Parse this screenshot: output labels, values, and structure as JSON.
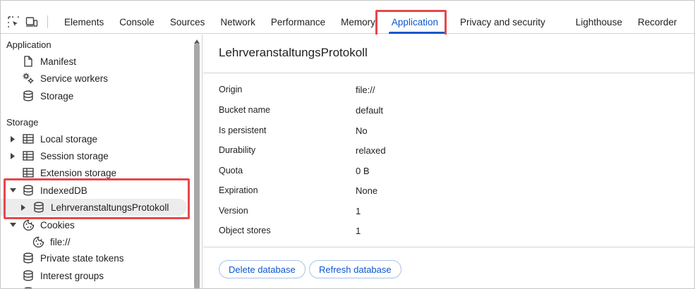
{
  "tabs": [
    "Elements",
    "Console",
    "Sources",
    "Network",
    "Performance",
    "Memory",
    "Application",
    "Privacy and security",
    "Lighthouse",
    "Recorder"
  ],
  "active_tab": "Application",
  "sidebar": {
    "application_heading": "Application",
    "application_items": [
      {
        "label": "Manifest",
        "icon": "document-icon"
      },
      {
        "label": "Service workers",
        "icon": "gears-icon"
      },
      {
        "label": "Storage",
        "icon": "database-icon"
      }
    ],
    "storage_heading": "Storage",
    "storage_items": {
      "local_storage": "Local storage",
      "session_storage": "Session storage",
      "extension_storage": "Extension storage",
      "indexeddb": "IndexedDB",
      "indexeddb_child": "LehrveranstaltungsProtokoll",
      "cookies": "Cookies",
      "cookies_child": "file://",
      "private_state_tokens": "Private state tokens",
      "interest_groups": "Interest groups"
    }
  },
  "main": {
    "title": "LehrveranstaltungsProtokoll",
    "properties": [
      {
        "key": "Origin",
        "value": "file://"
      },
      {
        "key": "Bucket name",
        "value": "default"
      },
      {
        "key": "Is persistent",
        "value": "No"
      },
      {
        "key": "Durability",
        "value": "relaxed"
      },
      {
        "key": "Quota",
        "value": "0 B"
      },
      {
        "key": "Expiration",
        "value": "None"
      },
      {
        "key": "Version",
        "value": "1"
      },
      {
        "key": "Object stores",
        "value": "1"
      }
    ],
    "delete_button": "Delete database",
    "refresh_button": "Refresh database"
  },
  "colors": {
    "accent": "#0b57d0",
    "highlight": "#e5484d"
  }
}
